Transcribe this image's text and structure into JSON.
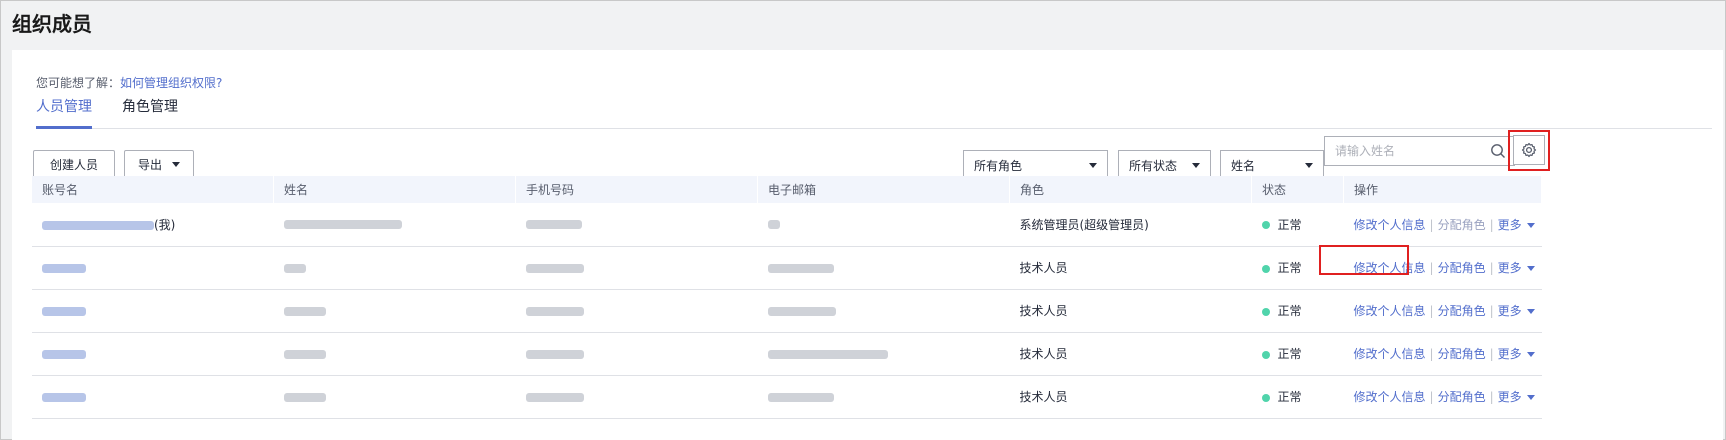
{
  "page": {
    "title": "组织成员"
  },
  "hint": {
    "prefix": "您可能想了解：",
    "link": "如何管理组织权限?"
  },
  "tabs": [
    {
      "label": "人员管理",
      "active": true
    },
    {
      "label": "角色管理",
      "active": false
    }
  ],
  "toolbar": {
    "create_label": "创建人员",
    "export_label": "导出"
  },
  "filters": {
    "role_select": "所有角色",
    "status_select": "所有状态",
    "field_select": "姓名",
    "search_placeholder": "请输入姓名"
  },
  "table": {
    "headers": [
      "账号名",
      "姓名",
      "手机号码",
      "电子邮箱",
      "角色",
      "状态",
      "操作"
    ],
    "rows": [
      {
        "account_suffix": "(我)",
        "role": "系统管理员(超级管理员)",
        "status": "正常"
      },
      {
        "account_suffix": "",
        "role": "技术人员",
        "status": "正常"
      },
      {
        "account_suffix": "",
        "role": "技术人员",
        "status": "正常"
      },
      {
        "account_suffix": "",
        "role": "技术人员",
        "status": "正常"
      },
      {
        "account_suffix": "",
        "role": "技术人员",
        "status": "正常"
      }
    ],
    "actions": {
      "edit": "修改个人信息",
      "assign": "分配角色",
      "more": "更多"
    }
  },
  "colors": {
    "accent": "#526ecc",
    "status_ok": "#50d4ab",
    "highlight": "#e02020"
  }
}
